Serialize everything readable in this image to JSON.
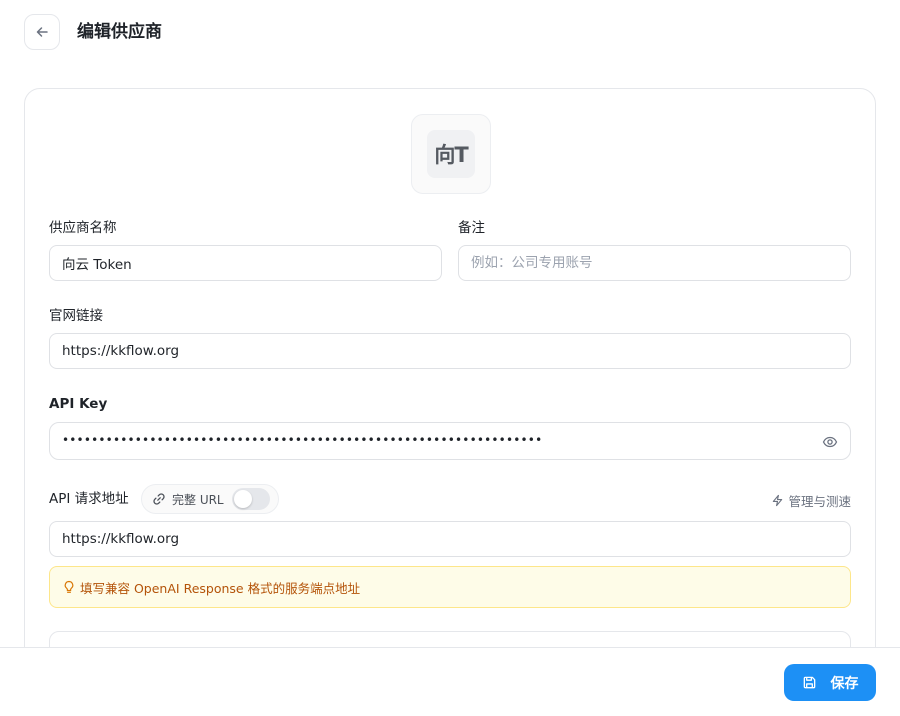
{
  "header": {
    "title": "编辑供应商"
  },
  "logo": {
    "text": "向T"
  },
  "form": {
    "name_label": "供应商名称",
    "name_value": "向云 Token",
    "note_label": "备注",
    "note_placeholder": "例如：公司专用账号",
    "website_label": "官网链接",
    "website_value": "https://kkflow.org",
    "api_key_label": "API Key",
    "api_key_masked": "••••••••••••••••••••••••••••••••••••••••••••••••••••••••••••••••••",
    "api_url_label": "API 请求地址",
    "full_url_label": "完整 URL",
    "full_url_enabled": false,
    "manage_label": "管理与测速",
    "api_url_value": "https://kkflow.org",
    "hint": "填写兼容 OpenAI Response 格式的服务端点地址"
  },
  "footer": {
    "save_label": "保存"
  },
  "colors": {
    "accent": "#1d90f5",
    "hint_bg": "#fefce8",
    "hint_text": "#b45309"
  }
}
